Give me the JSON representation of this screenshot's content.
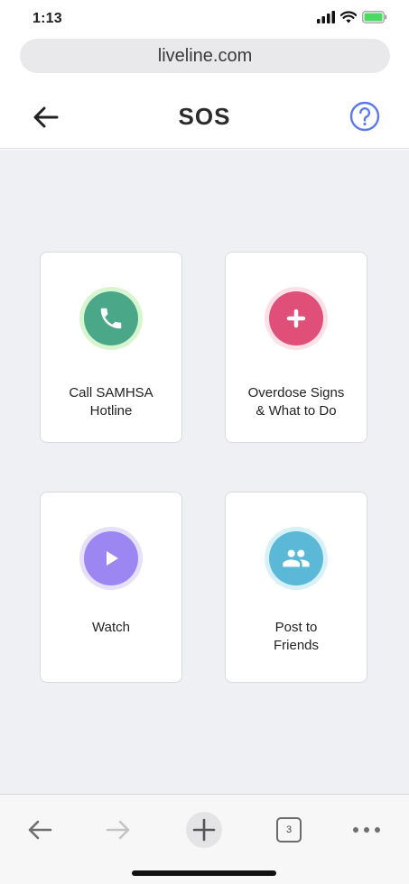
{
  "status_bar": {
    "time": "1:13",
    "icons": [
      "signal-icon",
      "wifi-icon",
      "battery-icon"
    ],
    "battery_color": "#4cd964"
  },
  "browser": {
    "url": "liveline.com"
  },
  "header": {
    "title": "SOS",
    "back_icon": "arrow-left-icon",
    "help_icon": "question-circle-icon",
    "help_color": "#5b7be8"
  },
  "cards": [
    {
      "line1": "Call SAMHSA",
      "line2": "Hotline",
      "icon": "phone-icon",
      "color": "#4aa889",
      "ring": "#d9f5cf"
    },
    {
      "line1": "Overdose Signs",
      "line2": "& What to Do",
      "icon": "plus-icon",
      "color": "#e04f78",
      "ring": "#fbe0e8"
    },
    {
      "line1": "Watch",
      "line2": "",
      "icon": "play-icon",
      "color": "#9b86f2",
      "ring": "#e6e0fb"
    },
    {
      "line1": "Post to",
      "line2": "Friends",
      "icon": "group-icon",
      "color": "#5bb8d6",
      "ring": "#d8f1f8"
    }
  ],
  "toolbar": {
    "tabs_count": "3",
    "items": [
      "back-icon",
      "forward-icon",
      "new-tab-icon",
      "tabs-icon",
      "more-icon"
    ]
  }
}
